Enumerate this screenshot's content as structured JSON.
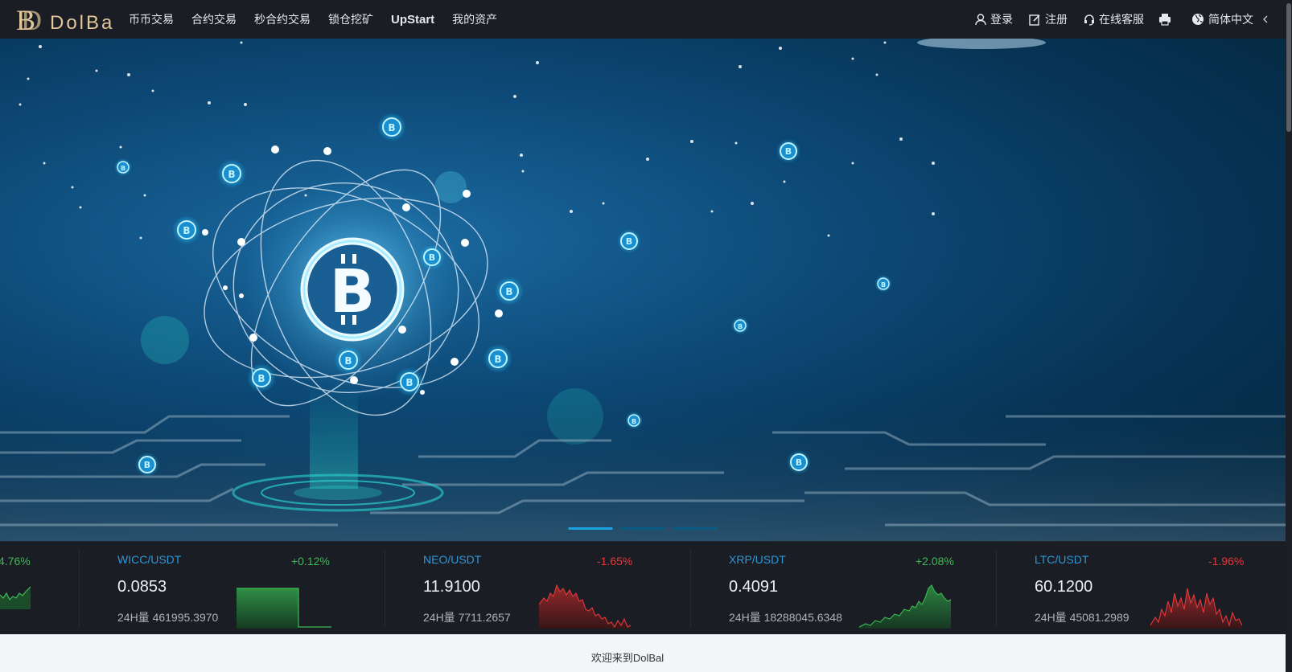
{
  "header": {
    "logo_text": "DolBal",
    "nav": [
      {
        "label": "币币交易"
      },
      {
        "label": "合约交易"
      },
      {
        "label": "秒合约交易"
      },
      {
        "label": "锁仓挖矿"
      },
      {
        "label": "UpStart"
      },
      {
        "label": "我的资产"
      }
    ],
    "login": "登录",
    "register": "注册",
    "support": "在线客服",
    "language": "简体中文",
    "icons": [
      "user-icon",
      "edit-icon",
      "headset-icon",
      "printer-icon",
      "globe-icon",
      "chevron-left-icon"
    ]
  },
  "banner": {
    "slides": 3,
    "active_slide": 0
  },
  "tickers": [
    {
      "pair": "",
      "change": "4.76%",
      "direction": "up",
      "price": "",
      "volume": ""
    },
    {
      "pair": "WICC/USDT",
      "change": "+0.12%",
      "direction": "up",
      "price": "0.0853",
      "volume": "24H量 461995.3970"
    },
    {
      "pair": "NEO/USDT",
      "change": "-1.65%",
      "direction": "down",
      "price": "11.9100",
      "volume": "24H量 7711.2657"
    },
    {
      "pair": "XRP/USDT",
      "change": "+2.08%",
      "direction": "up",
      "price": "0.4091",
      "volume": "24H量 18288045.6348"
    },
    {
      "pair": "LTC/USDT",
      "change": "-1.96%",
      "direction": "down",
      "price": "60.1200",
      "volume": "24H量 45081.2989"
    }
  ],
  "welcome": "欢迎来到DolBal",
  "colors": {
    "up": "#3cba54",
    "down": "#e5383b",
    "pair": "#2f97d6",
    "header_bg": "#1a1d23"
  }
}
